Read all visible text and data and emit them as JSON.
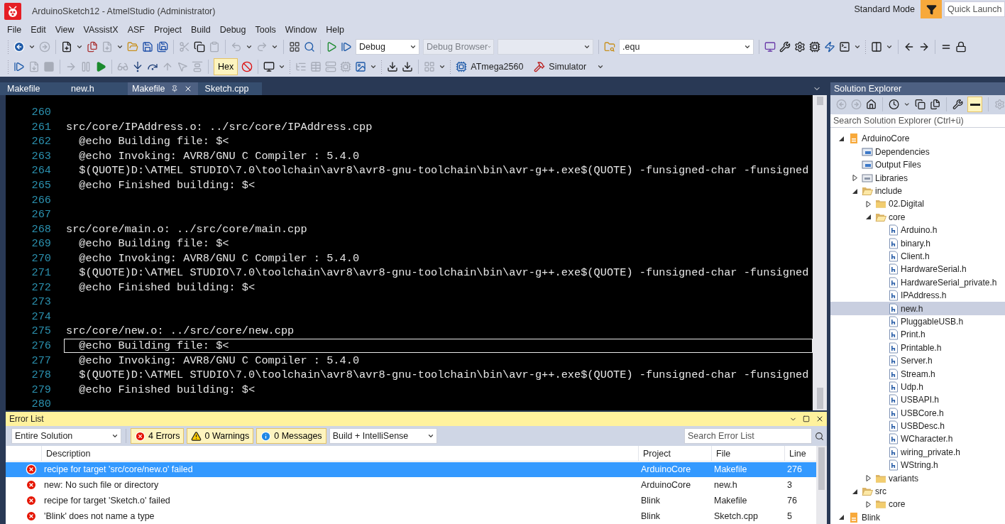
{
  "window": {
    "title": "ArduinoSketch12 - AtmelStudio (Administrator)",
    "mode": "Standard Mode",
    "quick_launch": {
      "placeholder": "Quick Launch"
    }
  },
  "menu": [
    "File",
    "Edit",
    "View",
    "VAssistX",
    "ASF",
    "Project",
    "Build",
    "Debug",
    "Tools",
    "Window",
    "Help"
  ],
  "toolbar": {
    "configuration": "Debug",
    "debug_browser": "Debug Browser",
    "find": ".equ",
    "hex": {
      "label": "Hex",
      "on": true
    },
    "device": "ATmega2560",
    "tool": "Simulator"
  },
  "tabs": [
    {
      "label": "Makefile",
      "selected": false
    },
    {
      "label": "new.h",
      "selected": false
    },
    {
      "label": "Makefile",
      "selected": true
    },
    {
      "label": "Sketch.cpp",
      "selected": false
    }
  ],
  "editor": {
    "lines": [
      {
        "number": "260",
        "current": false
      },
      {
        "number": "261",
        "text": "src/core/IPAddress.o: ../src/core/IPAddress.cpp",
        "current": false
      },
      {
        "number": "262",
        "text": "  @echo Building file: $<",
        "current": false
      },
      {
        "number": "263",
        "text": "  @echo Invoking: AVR8/GNU C Compiler : 5.4.0",
        "current": false
      },
      {
        "number": "264",
        "text": "  $(QUOTE)D:\\ATMEL STUDIO\\7.0\\toolchain\\avr8\\avr8-gnu-toolchain\\bin\\avr-g++.exe$(QUOTE) -funsigned-char -funsigned",
        "current": false
      },
      {
        "number": "265",
        "text": "  @echo Finished building: $<",
        "current": false
      },
      {
        "number": "266",
        "current": false
      },
      {
        "number": "267",
        "current": false
      },
      {
        "number": "268",
        "text": "src/core/main.o: ../src/core/main.cpp",
        "current": false
      },
      {
        "number": "269",
        "text": "  @echo Building file: $<",
        "current": false
      },
      {
        "number": "270",
        "text": "  @echo Invoking: AVR8/GNU C Compiler : 5.4.0",
        "current": false
      },
      {
        "number": "271",
        "text": "  $(QUOTE)D:\\ATMEL STUDIO\\7.0\\toolchain\\avr8\\avr8-gnu-toolchain\\bin\\avr-g++.exe$(QUOTE) -funsigned-char -funsigned",
        "current": false
      },
      {
        "number": "272",
        "text": "  @echo Finished building: $<",
        "current": false
      },
      {
        "number": "273",
        "current": false
      },
      {
        "number": "274",
        "current": false
      },
      {
        "number": "275",
        "text": "src/core/new.o: ../src/core/new.cpp",
        "current": false
      },
      {
        "number": "276",
        "text": "  @echo Building file: $<",
        "current": true
      },
      {
        "number": "277",
        "text": "  @echo Invoking: AVR8/GNU C Compiler : 5.4.0",
        "current": false
      },
      {
        "number": "278",
        "text": "  $(QUOTE)D:\\ATMEL STUDIO\\7.0\\toolchain\\avr8\\avr8-gnu-toolchain\\bin\\avr-g++.exe$(QUOTE) -funsigned-char -funsigned",
        "current": false
      },
      {
        "number": "279",
        "text": "  @echo Finished building: $<",
        "current": false
      },
      {
        "number": "280",
        "current": false
      }
    ]
  },
  "error_list": {
    "title": "Error List",
    "scope": "Entire Solution",
    "filters": [
      {
        "label": "4 Errors",
        "kind": "error",
        "on": true
      },
      {
        "label": "0 Warnings",
        "kind": "warning",
        "on": true
      },
      {
        "label": "0 Messages",
        "kind": "message",
        "on": true
      }
    ],
    "source": "Build + IntelliSense",
    "search": {
      "placeholder": "Search Error List"
    },
    "columns": [
      "Description",
      "Project",
      "File",
      "Line"
    ],
    "rows": [
      {
        "description": "recipe for target 'src/core/new.o' failed",
        "project": "ArduinoCore",
        "file": "Makefile",
        "line": "276",
        "selected": true
      },
      {
        "description": "new: No such file or directory",
        "project": "ArduinoCore",
        "file": "new.h",
        "line": "3",
        "selected": false
      },
      {
        "description": "recipe for target 'Sketch.o' failed",
        "project": "Blink",
        "file": "Makefile",
        "line": "76",
        "selected": false
      },
      {
        "description": "'Blink' does not name a type",
        "project": "Blink",
        "file": "Sketch.cpp",
        "line": "5",
        "selected": false
      }
    ]
  },
  "solution_explorer": {
    "title": "Solution Explorer",
    "toolbar_toggle": {
      "on": true
    },
    "search": {
      "placeholder": "Search Solution Explorer (Ctrl+ü)"
    },
    "tree": [
      {
        "label": "ArduinoCore",
        "kind": "project",
        "expanded": true,
        "selected": false,
        "children": [
          {
            "label": "Dependencies",
            "kind": "dependencies",
            "selected": false
          },
          {
            "label": "Output Files",
            "kind": "dependencies",
            "selected": false
          },
          {
            "label": "Libraries",
            "kind": "library",
            "expanded": false,
            "selected": false
          },
          {
            "label": "include",
            "kind": "folder",
            "expanded": true,
            "selected": false,
            "children": [
              {
                "label": "02.Digital",
                "kind": "folder",
                "expanded": false,
                "selected": false
              },
              {
                "label": "core",
                "kind": "folder",
                "expanded": true,
                "selected": false,
                "children": [
                  {
                    "label": "Arduino.h",
                    "kind": "file",
                    "selected": false
                  },
                  {
                    "label": "binary.h",
                    "kind": "file",
                    "selected": false
                  },
                  {
                    "label": "Client.h",
                    "kind": "file",
                    "selected": false
                  },
                  {
                    "label": "HardwareSerial.h",
                    "kind": "file",
                    "selected": false
                  },
                  {
                    "label": "HardwareSerial_private.h",
                    "kind": "file",
                    "selected": false
                  },
                  {
                    "label": "IPAddress.h",
                    "kind": "file",
                    "selected": false
                  },
                  {
                    "label": "new.h",
                    "kind": "file",
                    "selected": true
                  },
                  {
                    "label": "PluggableUSB.h",
                    "kind": "file",
                    "selected": false
                  },
                  {
                    "label": "Print.h",
                    "kind": "file",
                    "selected": false
                  },
                  {
                    "label": "Printable.h",
                    "kind": "file",
                    "selected": false
                  },
                  {
                    "label": "Server.h",
                    "kind": "file",
                    "selected": false
                  },
                  {
                    "label": "Stream.h",
                    "kind": "file",
                    "selected": false
                  },
                  {
                    "label": "Udp.h",
                    "kind": "file",
                    "selected": false
                  },
                  {
                    "label": "USBAPI.h",
                    "kind": "file",
                    "selected": false
                  },
                  {
                    "label": "USBCore.h",
                    "kind": "file",
                    "selected": false
                  },
                  {
                    "label": "USBDesc.h",
                    "kind": "file",
                    "selected": false
                  },
                  {
                    "label": "WCharacter.h",
                    "kind": "file",
                    "selected": false
                  },
                  {
                    "label": "wiring_private.h",
                    "kind": "file",
                    "selected": false
                  },
                  {
                    "label": "WString.h",
                    "kind": "file",
                    "selected": false
                  }
                ]
              },
              {
                "label": "variants",
                "kind": "folder",
                "expanded": false,
                "selected": false
              }
            ]
          },
          {
            "label": "src",
            "kind": "folder",
            "expanded": true,
            "selected": false,
            "children": [
              {
                "label": "core",
                "kind": "folder",
                "expanded": false,
                "selected": false
              }
            ]
          }
        ]
      },
      {
        "label": "Blink",
        "kind": "project",
        "expanded": true,
        "selected": false
      }
    ]
  }
}
